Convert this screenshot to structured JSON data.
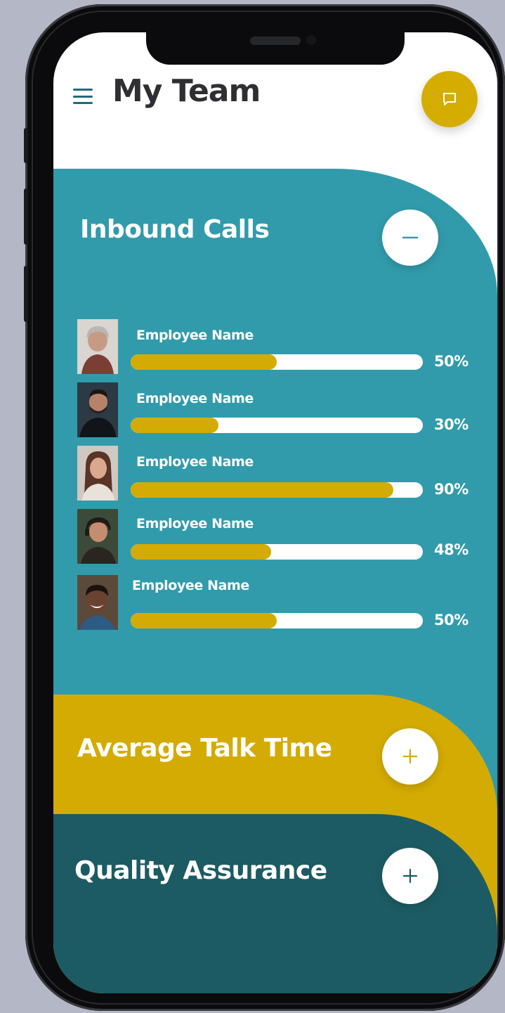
{
  "header": {
    "title": "My Team",
    "menu_icon": "hamburger-menu-icon",
    "chat_icon": "chat-bubble-icon"
  },
  "colors": {
    "background": "#b4b8c6",
    "teal": "#319bab",
    "gold": "#d4ab02",
    "dark_teal": "#1c5b63",
    "title_text": "#2f2f33"
  },
  "sections": {
    "inbound": {
      "title": "Inbound Calls",
      "toggle_icon": "minus-icon",
      "employees": [
        {
          "name": "Employee Name",
          "percent_label": "50%",
          "progress": 0.5
        },
        {
          "name": "Employee Name",
          "percent_label": "30%",
          "progress": 0.3
        },
        {
          "name": "Employee Name",
          "percent_label": "90%",
          "progress": 0.9
        },
        {
          "name": "Employee Name",
          "percent_label": "48%",
          "progress": 0.48
        },
        {
          "name": "Employee Name",
          "percent_label": "50%",
          "progress": 0.5
        }
      ]
    },
    "talk_time": {
      "title": "Average Talk Time",
      "toggle_icon": "plus-icon"
    },
    "quality": {
      "title": "Quality Assurance",
      "toggle_icon": "plus-icon"
    }
  }
}
